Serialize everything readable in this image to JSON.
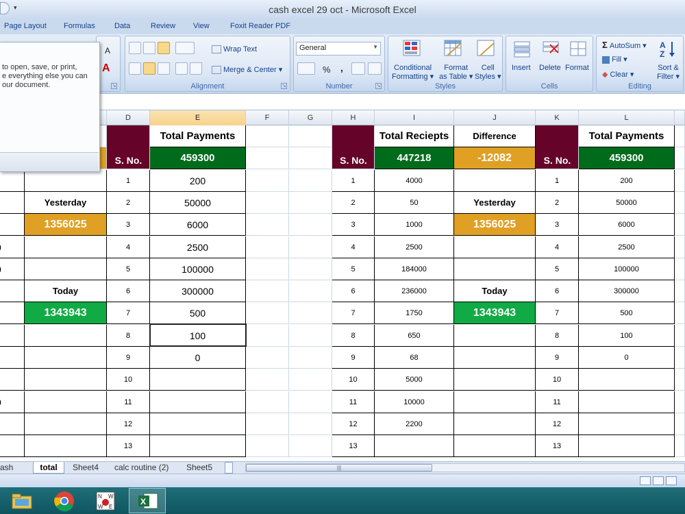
{
  "window": {
    "title": "cash excel 29 oct - Microsoft Excel"
  },
  "ribbon_tabs": [
    "Page Layout",
    "Formulas",
    "Data",
    "Review",
    "View",
    "Foxit Reader PDF"
  ],
  "ribbon": {
    "alignment": {
      "wrap_text": "Wrap Text",
      "merge_center": "Merge & Center",
      "label": "Alignment"
    },
    "number": {
      "format": "General",
      "percent": "%",
      "comma": ",",
      "label": "Number"
    },
    "styles": {
      "conditional": "Conditional",
      "formatting": "Formatting",
      "format_as": "Format",
      "as_table": "as Table",
      "cell": "Cell",
      "styles_btn": "Styles",
      "label": "Styles"
    },
    "cells": {
      "insert": "Insert",
      "delete": "Delete",
      "format": "Format",
      "label": "Cells"
    },
    "editing": {
      "autosum": "AutoSum",
      "fill": "Fill",
      "clear": "Clear",
      "sort": "Sort &",
      "filter": "Filter",
      "label": "Editing"
    },
    "font": {
      "grow": "A",
      "color": "A"
    }
  },
  "tooltip": {
    "lines": [
      "to open, save, or print,",
      "e everything else you can",
      "our document."
    ]
  },
  "columns": {
    "D": "D",
    "E": "E",
    "F": "F",
    "G": "G",
    "H": "H",
    "I": "I",
    "J": "J",
    "K": "K",
    "L": "L"
  },
  "left_table": {
    "title": "Total Payments",
    "sno_label": "S. No.",
    "total": "459300",
    "yesterday_label": "Yesterday",
    "yesterday_value": "1356025",
    "today_label": "Today",
    "today_value": "1343943",
    "rows": [
      {
        "n": "1",
        "v": "200"
      },
      {
        "n": "2",
        "v": "50000"
      },
      {
        "n": "3",
        "v": "6000"
      },
      {
        "n": "4",
        "v": "2500"
      },
      {
        "n": "5",
        "v": "100000"
      },
      {
        "n": "6",
        "v": "300000"
      },
      {
        "n": "7",
        "v": "500"
      },
      {
        "n": "8",
        "v": "100"
      },
      {
        "n": "9",
        "v": "0"
      },
      {
        "n": "10",
        "v": ""
      },
      {
        "n": "11",
        "v": ""
      },
      {
        "n": "12",
        "v": ""
      },
      {
        "n": "13",
        "v": ""
      }
    ],
    "partial_a": [
      "0",
      "0",
      "",
      "",
      "0"
    ]
  },
  "right_table": {
    "receipts_title": "Total Reciepts",
    "sno_label": "S. No.",
    "receipts_total": "447218",
    "difference_label": "Difference",
    "difference_value": "-12082",
    "yesterday_label": "Yesterday",
    "yesterday_value": "1356025",
    "today_label": "Today",
    "today_value": "1343943",
    "payments_title": "Total Payments",
    "payments_total": "459300",
    "rows": [
      {
        "n": "1",
        "r": "4000",
        "p": "200"
      },
      {
        "n": "2",
        "r": "50",
        "p": "50000"
      },
      {
        "n": "3",
        "r": "1000",
        "p": "6000"
      },
      {
        "n": "4",
        "r": "2500",
        "p": "2500"
      },
      {
        "n": "5",
        "r": "184000",
        "p": "100000"
      },
      {
        "n": "6",
        "r": "236000",
        "p": "300000"
      },
      {
        "n": "7",
        "r": "1750",
        "p": "500"
      },
      {
        "n": "8",
        "r": "650",
        "p": "100"
      },
      {
        "n": "9",
        "r": "68",
        "p": "0"
      },
      {
        "n": "10",
        "r": "5000",
        "p": ""
      },
      {
        "n": "11",
        "r": "10000",
        "p": ""
      },
      {
        "n": "12",
        "r": "2200",
        "p": ""
      },
      {
        "n": "13",
        "r": "",
        "p": ""
      }
    ]
  },
  "sheet_tabs": [
    "ash tally",
    "total",
    "Sheet4",
    "calc routine (2)",
    "Sheet5"
  ],
  "active_sheet": "total",
  "colors": {
    "maroon": "#650428",
    "dark_green": "#006b1b",
    "orange": "#dfa023",
    "green": "#10ab44"
  }
}
